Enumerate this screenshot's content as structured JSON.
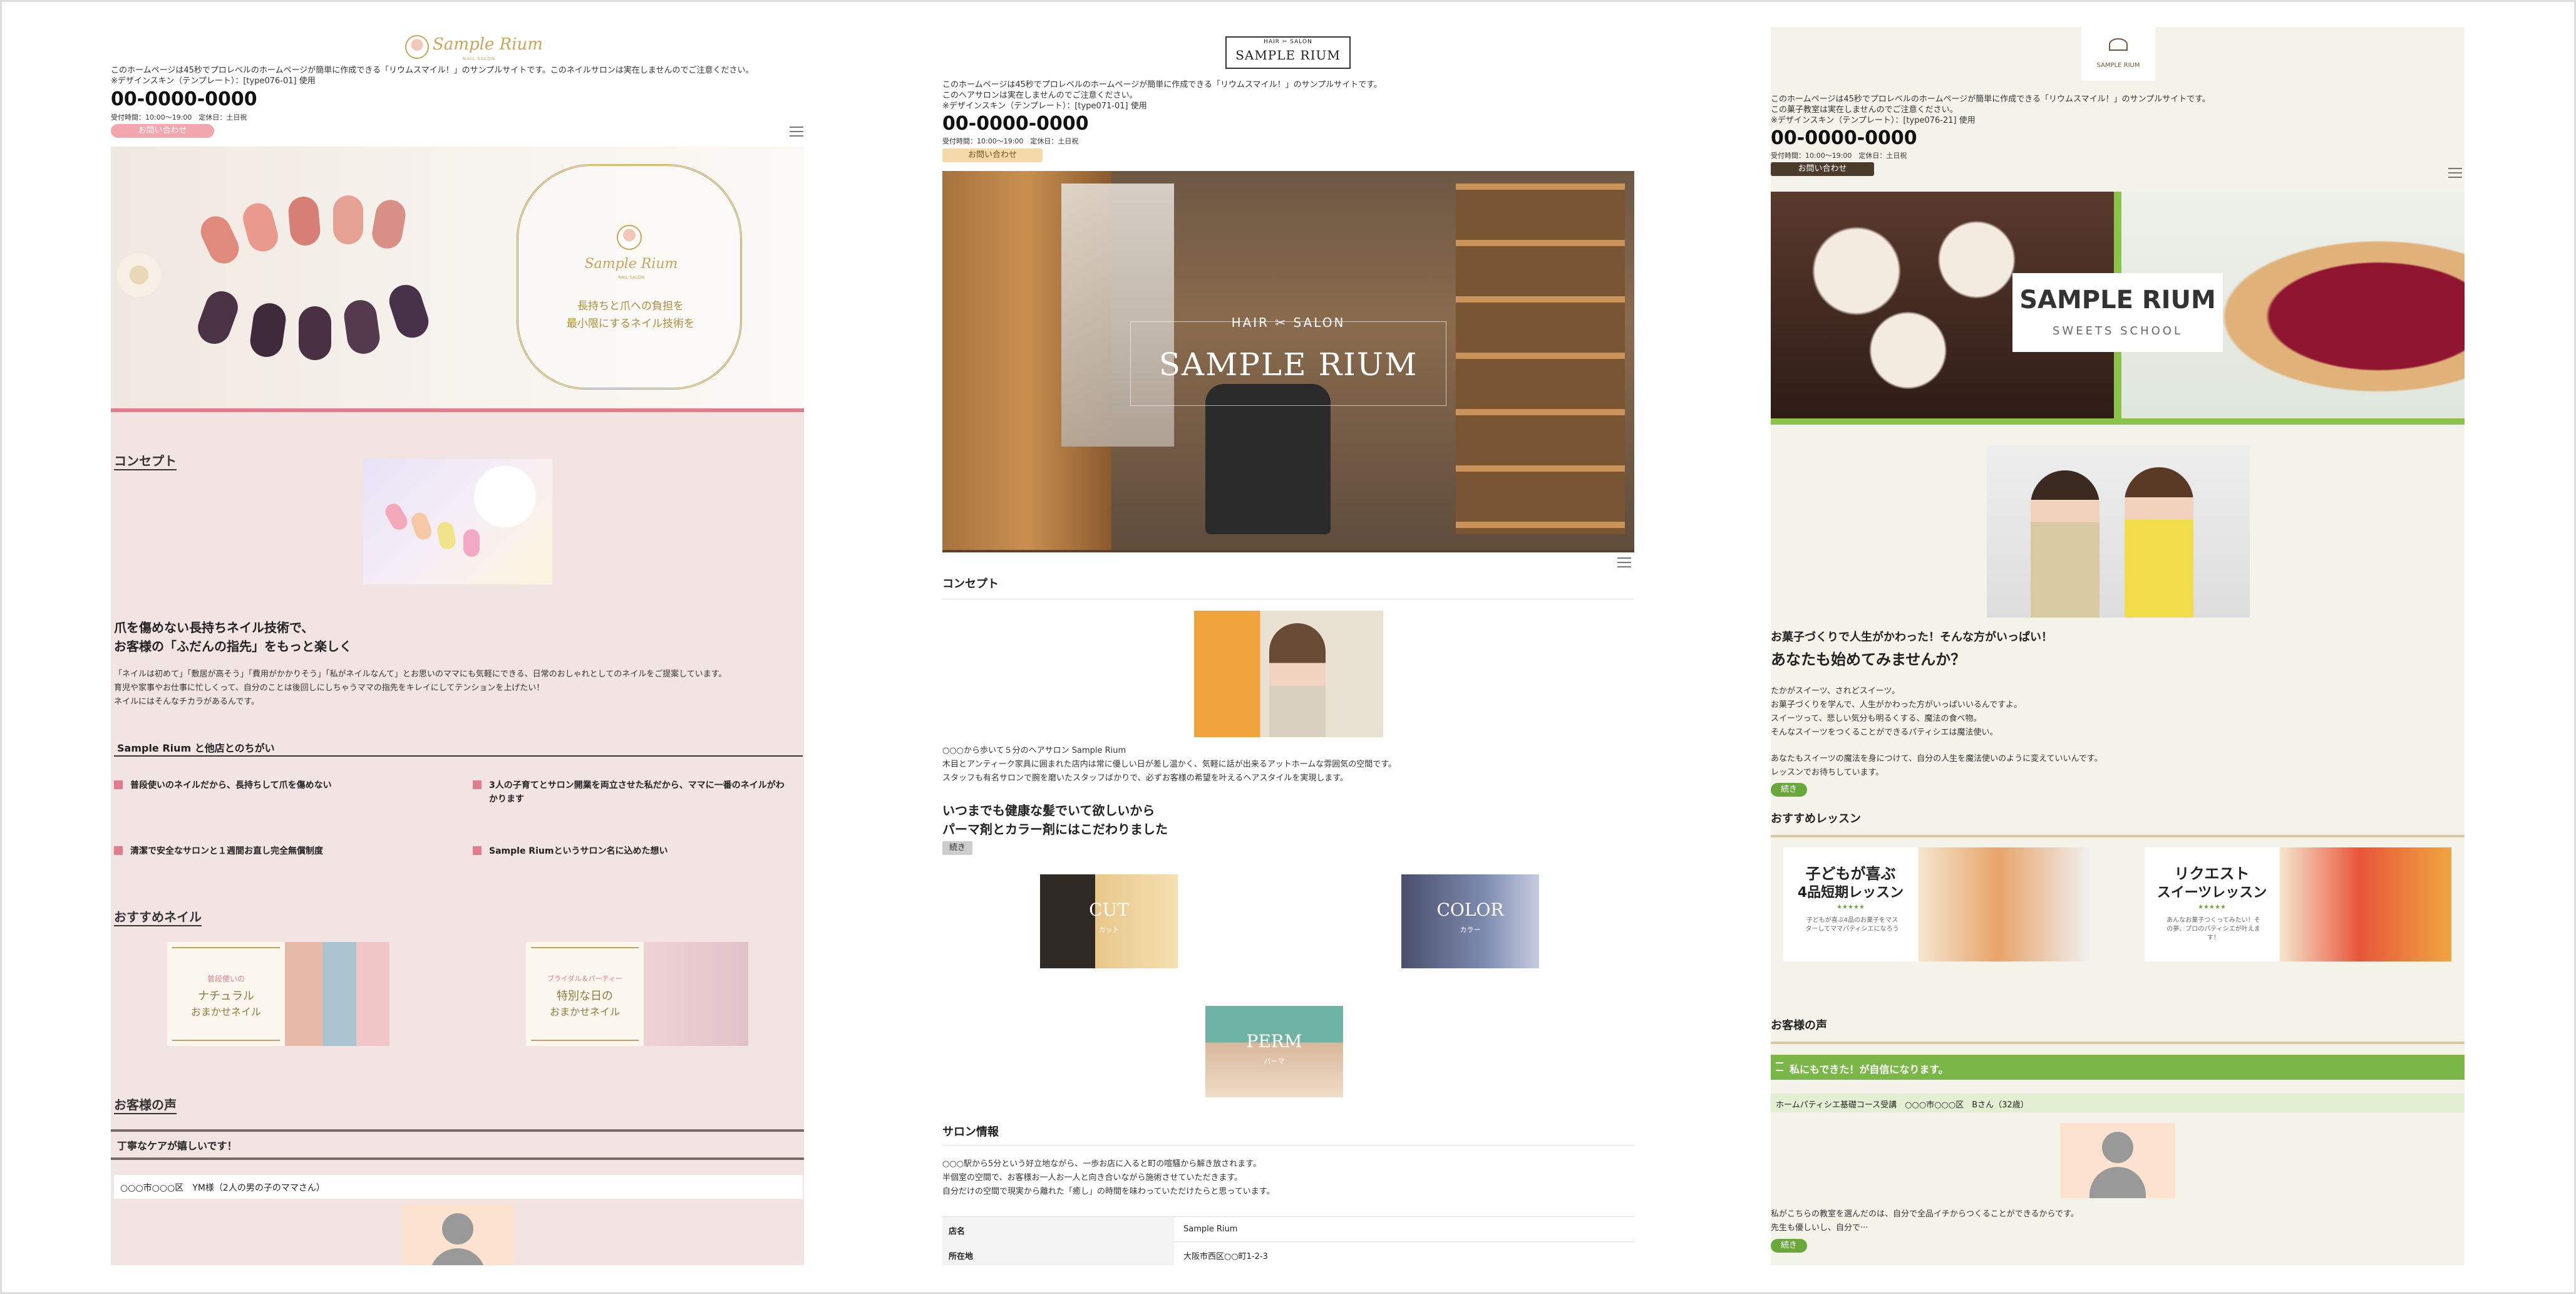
{
  "p1": {
    "logo_text": "Sample Rium",
    "logo_sub": "NAIL SALON",
    "notice": "このホームページは45秒でプロレベルのホームページが簡単に作成できる「リウムスマイル！」のサンプルサイトです。このネイルサロンは実在しませんのでご注意ください。",
    "design": "※デザインスキン（テンプレート）：[type076-01] 使用",
    "phone": "00-0000-0000",
    "hours": "受付時間：10:00〜19:00　定休日：土日祝",
    "contact_btn": "お問い合わせ",
    "hero_logo": "Sample Rium",
    "hero_sub": "NAIL SALON",
    "hero_copy1": "長持ちと爪への負担を",
    "hero_copy2": "最小限にするネイル技術を",
    "concept_title": "コンセプト",
    "concept_head1": "爪を傷めない長持ちネイル技術で、",
    "concept_head2": "お客様の「ふだんの指先」をもっと楽しく",
    "concept_p1": "「ネイルは初めて」「敷居が高そう」「費用がかかりそう」「私がネイルなんて」とお思いのママにも気軽にできる、日常のおしゃれとしてのネイルをご提案しています。",
    "concept_p2": "育児や家事やお仕事に忙しくって、自分のことは後回しにしちゃうママの指先をキレイにしてテンションを上げたい！",
    "concept_p3": "ネイルにはそんなチカラがあるんです。",
    "diff_title": "Sample Rium と他店とのちがい",
    "diff": [
      {
        "l1": "普段使いのネイルだから、長持ちして爪を傷めない",
        "l2": ""
      },
      {
        "l1": "3人の子育てとサロン開業を両立させた私だから、ママに一番のネイルがわ",
        "l2": "かります"
      },
      {
        "l1": "清潔で安全なサロンと１週間お直し完全無償制度",
        "l2": ""
      },
      {
        "l1": "Sample Riumというサロン名に込めた想い",
        "l2": ""
      }
    ],
    "recommend_title": "おすすめネイル",
    "card1": {
      "l1": "普段使いの",
      "l2": "ナチュラル",
      "l3": "おまかせネイル"
    },
    "card2": {
      "l1": "ブライダル＆パーティー",
      "l2": "特別な日の",
      "l3": "おまかせネイル"
    },
    "voice_title": "お客様の声",
    "voice_head": "丁寧なケアが嬉しいです！",
    "voice_name": "○○○市○○○区　YM様（2人の男の子のママさん）"
  },
  "p2": {
    "logo_top": "HAIR ✂ SALON",
    "logo_main": "SAMPLE RIUM",
    "notice1": "このホームページは45秒でプロレベルのホームページが簡単に作成できる「リウムスマイル！」のサンプルサイトです。",
    "notice2": "このヘアサロンは実在しませんのでご注意ください。",
    "design": "※デザインスキン（テンプレート）：[type071-01] 使用",
    "phone": "00-0000-0000",
    "hours": "受付時間：10:00〜19:00　定休日：土日祝",
    "contact_btn": "お問い合わせ",
    "hero_top": "HAIR ✂ SALON",
    "hero_main": "SAMPLE RIUM",
    "concept_title": "コンセプト",
    "concept_p1": "○○○から歩いて５分のヘアサロン Sample Rium",
    "concept_p2": "木目とアンティーク家具に囲まれた店内は常に優しい日が差し温かく、気軽に話が出来るアットホームな雰囲気の空間です。",
    "concept_p3": "スタッフも有名サロンで腕を磨いたスタッフばかりで、必ずお客様の希望を叶えるヘアスタイルを実現します。",
    "concept_head1": "いつまでも健康な髪でいて欲しいから",
    "concept_head2": "パーマ剤とカラー剤にはこだわりました",
    "more_btn": "続き",
    "cut_en": "CUT",
    "cut_jp": "カット",
    "color_en": "COLOR",
    "color_jp": "カラー",
    "perm_en": "PERM",
    "perm_jp": "パーマ",
    "salon_title": "サロン情報",
    "salon_p1": "○○○駅から5分という好立地ながら、一歩お店に入ると町の喧騒から解き放されます。",
    "salon_p2": "半個室の空間で、お客様お一人お一人と向き合いながら施術させていただきます。",
    "salon_p3": "自分だけの空間で現実から離れた「癒し」の時間を味わっていただけたらと思っています。",
    "table": [
      {
        "k": "店名",
        "v": "Sample Rium"
      },
      {
        "k": "所在地",
        "v": "大阪市西区○○町1-2-3"
      }
    ]
  },
  "p3": {
    "logo_sub": "SAMPLE RIUM",
    "notice1": "このホームページは45秒でプロレベルのホームページが簡単に作成できる「リウムスマイル！」のサンプルサイトです。",
    "notice2": "この菓子教室は実在しませんのでご注意ください。",
    "design": "※デザインスキン（テンプレート）：[type076-21] 使用",
    "phone": "00-0000-0000",
    "hours": "受付時間：10:00〜19:00　定休日：土日祝",
    "contact_btn": "お問い合わせ",
    "hero_main": "SAMPLE RIUM",
    "hero_sub": "SWEETS SCHOOL",
    "lead1": "お菓子づくりで人生がかわった！そんな方がいっぱい！",
    "lead2": "あなたも始めてみませんか？",
    "para1": "たかがスイーツ、されどスイーツ。",
    "para2": "お菓子づくりを学んで、人生がかわった方がいっぱいいるんですよ。",
    "para3": "スイーツって、悲しい気分も明るくする、魔法の食べ物。",
    "para4": "そんなスイーツをつくることができるパティシエは魔法使い。",
    "para5": "あなたもスイーツの魔法を身につけて、自分の人生を魔法使いのように変えていいんです。",
    "para6": "レッスンでお待ちしています。",
    "more_btn": "続き",
    "lesson_title": "おすすめレッスン",
    "lesson1": {
      "t1": "子どもが喜ぶ",
      "t2": "4品短期レッスン",
      "d": "子どもが喜ぶ4品のお菓子をマスターしてママパティシエになろう"
    },
    "lesson2": {
      "t1": "リクエスト",
      "t2": "スイーツレッスン",
      "d": "あんなお菓子つくってみたい！その夢、プロのパティシエが叶えます！"
    },
    "voice_title": "お客様の声",
    "voice_bar": "私にもできた！が自信になります。",
    "voice_sub": "ホームパティシエ基礎コース受講　○○○市○○○区　Bさん（32歳）",
    "voice_p1": "私がこちらの教室を選んだのは、自分で全品イチからつくることができるからです。",
    "voice_p2": "先生も優しいし、自分で···",
    "voice_btn": "続き"
  }
}
